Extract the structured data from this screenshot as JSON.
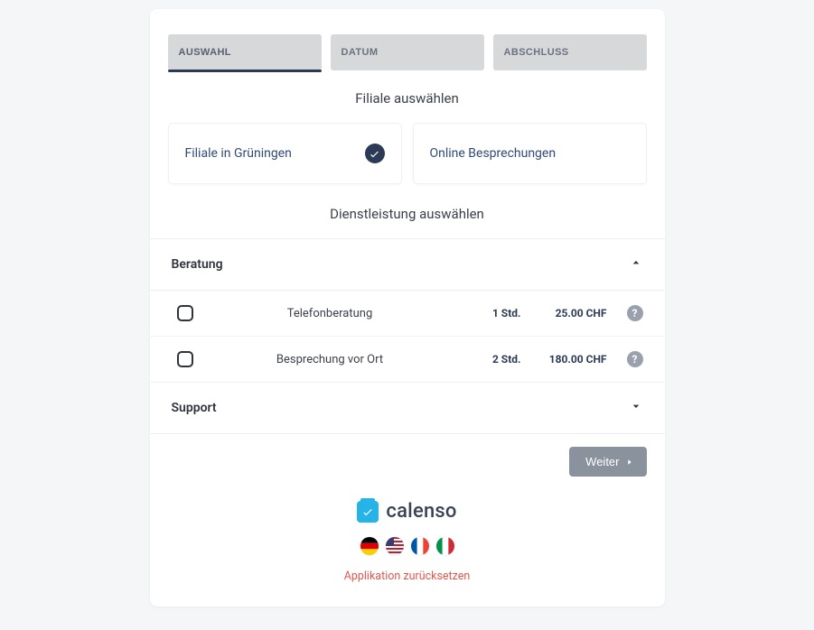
{
  "tabs": {
    "auswahl": "AUSWAHL",
    "datum": "DATUM",
    "abschluss": "ABSCHLUSS"
  },
  "section_branch_title": "Filiale auswählen",
  "branches": {
    "gruningen": "Filiale in Grüningen",
    "online": "Online Besprechungen"
  },
  "section_service_title": "Dienstleistung auswählen",
  "categories": {
    "beratung": "Beratung",
    "support": "Support"
  },
  "services": {
    "telefon": {
      "name": "Telefonberatung",
      "duration": "1 Std.",
      "price": "25.00 CHF"
    },
    "vorort": {
      "name": "Besprechung vor Ort",
      "duration": "2 Std.",
      "price": "180.00 CHF"
    }
  },
  "next_label": "Weiter",
  "logo_text": "calenso",
  "reset_label": "Applikation zurücksetzen"
}
